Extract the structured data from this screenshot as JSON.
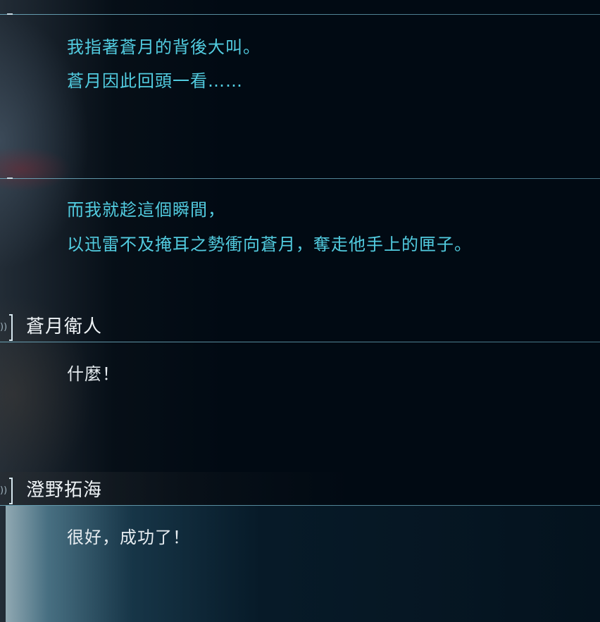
{
  "backlog": {
    "entries": [
      {
        "type": "narration",
        "lines": [
          "我指著蒼月的背後大叫。",
          "蒼月因此回頭一看……"
        ]
      },
      {
        "type": "narration",
        "lines": [
          "而我就趁這個瞬間，",
          "以迅雷不及掩耳之勢衝向蒼月，奪走他手上的匣子。"
        ]
      },
      {
        "type": "dialogue",
        "speaker": "蒼月衛人",
        "lines": [
          "什麼！"
        ]
      },
      {
        "type": "dialogue",
        "speaker": "澄野拓海",
        "lines": [
          "很好，成功了！"
        ]
      }
    ]
  },
  "icons": {
    "voice_replay": "voice-replay-icon"
  },
  "colors": {
    "narration_text": "#52cce0",
    "dialogue_text": "#e6ecf0",
    "divider": "#6eaabe",
    "background": "#010a13"
  }
}
